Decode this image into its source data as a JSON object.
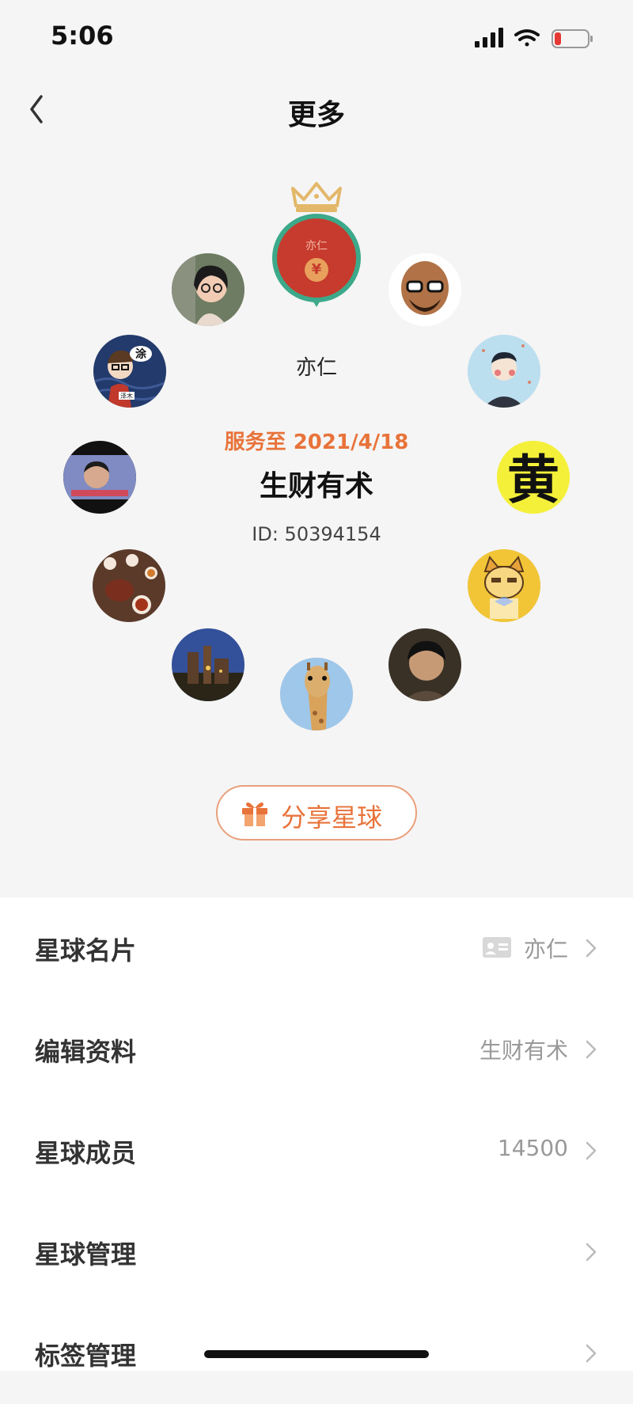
{
  "status": {
    "time": "5:06"
  },
  "nav": {
    "title": "更多"
  },
  "owner": {
    "name": "亦仁",
    "badge_text": "亦仁",
    "badge_coin": "¥"
  },
  "planet": {
    "expiry": "服务至 2021/4/18",
    "name": "生财有术",
    "id": "ID: 50394154"
  },
  "share": {
    "label": "分享星球"
  },
  "members": [
    {
      "avatar": "woman-with-glasses-photo"
    },
    {
      "avatar": "bald-man-with-glasses-cartoon"
    },
    {
      "avatar": "cartoon-man-with-pen"
    },
    {
      "avatar": "cartoon-boy-with-glasses",
      "badge_top": "涂",
      "badge_bottom": "泽木"
    },
    {
      "avatar": "yellow-character-avatar",
      "text": "黄"
    },
    {
      "avatar": "man-screenshot-photo"
    },
    {
      "avatar": "tea-set-photo"
    },
    {
      "avatar": "cartoon-cat-with-bowtie"
    },
    {
      "avatar": "castle-at-night-photo"
    },
    {
      "avatar": "boy-photo"
    },
    {
      "avatar": "giraffe-photo"
    }
  ],
  "menu": {
    "card": {
      "label": "星球名片",
      "value": "亦仁"
    },
    "edit": {
      "label": "编辑资料",
      "value": "生财有术"
    },
    "members": {
      "label": "星球成员",
      "value": "14500"
    },
    "manage": {
      "label": "星球管理",
      "value": ""
    },
    "tags": {
      "label": "标签管理",
      "value": ""
    }
  },
  "colors": {
    "accent": "#e8733a",
    "owner_ring": "#3ca98a",
    "owner_fill": "#c63b2d",
    "crown": "#e3b86a"
  }
}
